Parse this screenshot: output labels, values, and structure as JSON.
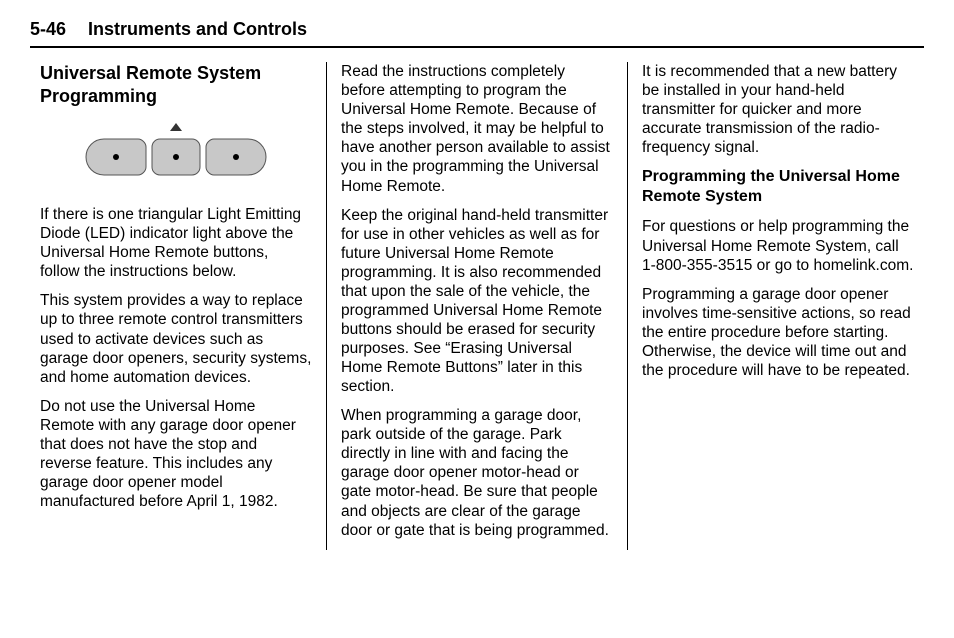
{
  "header": {
    "page": "5-46",
    "chapter": "Instruments and Controls"
  },
  "col1": {
    "title": "Universal Remote System Programming",
    "p1": "If there is one triangular Light Emitting Diode (LED) indicator light above the Universal Home Remote buttons, follow the instructions below.",
    "p2": "This system provides a way to replace up to three remote control transmitters used to activate devices such as garage door openers, security systems, and home automation devices.",
    "p3": "Do not use the Universal Home Remote with any garage door opener that does not have the stop and reverse feature. This includes any garage door opener model manufactured before April 1, 1982."
  },
  "col2": {
    "p1": "Read the instructions completely before attempting to program the Universal Home Remote. Because of the steps involved, it may be helpful to have another person available to assist you in the programming the Universal Home Remote.",
    "p2": "Keep the original hand-held transmitter for use in other vehicles as well as for future Universal Home Remote programming. It is also recommended that upon the sale of the vehicle, the programmed Universal Home Remote buttons should be erased for security purposes. See “Erasing Universal Home Remote Buttons” later in this section.",
    "p3": "When programming a garage door, park outside of the garage. Park directly in line with and facing the garage door opener motor-head or gate motor-head. Be sure that people and objects are clear of the garage door or gate that is being programmed."
  },
  "col3": {
    "p1": "It is recommended that a new battery be installed in your hand-held transmitter for quicker and more accurate transmission of the radio-frequency signal.",
    "subtitle": "Programming the Universal Home Remote System",
    "p2": "For questions or help programming the Universal Home Remote System, call 1-800-355-3515 or go to homelink.com.",
    "p3": "Programming a garage door opener involves time-sensitive actions, so read the entire procedure before starting. Otherwise, the device will time out and the procedure will have to be repeated."
  }
}
